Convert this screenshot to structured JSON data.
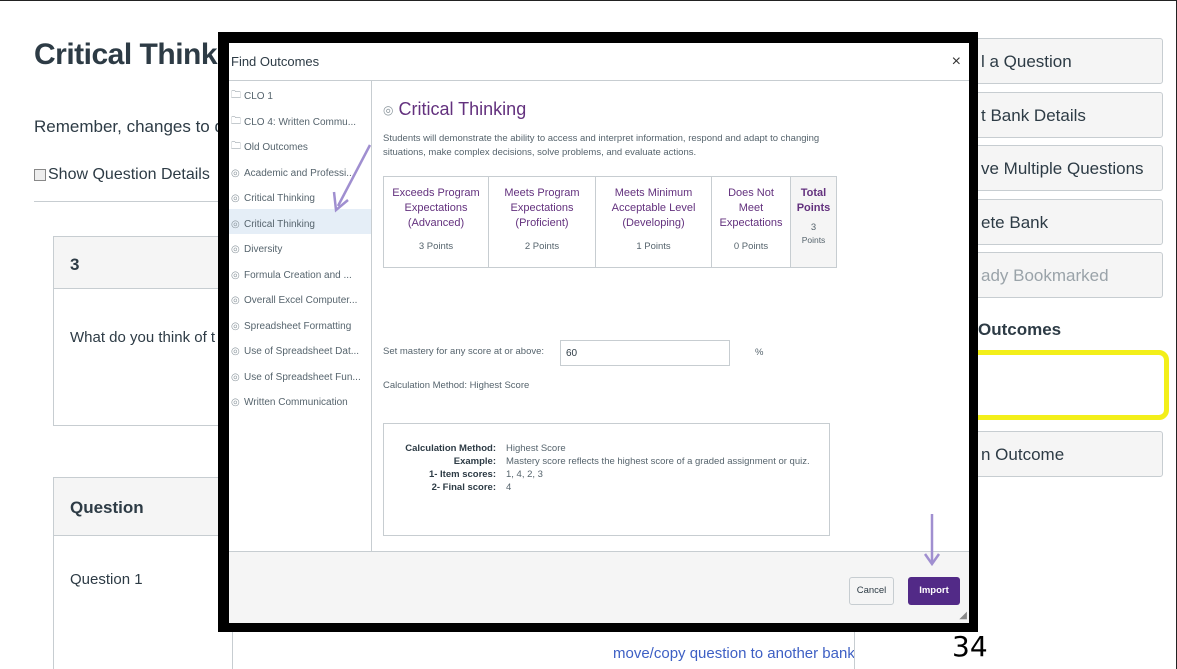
{
  "page": {
    "title": "Critical Thinki",
    "note": "Remember, changes to qu",
    "show_details_label": "Show Question Details",
    "question_card": {
      "number": "3",
      "text": "What do you think of t"
    },
    "question_card2": {
      "heading": "Question",
      "text": "Question 1"
    },
    "move_link": "move/copy question to another bank",
    "page_number": "34"
  },
  "sidebar": {
    "buttons": [
      {
        "label": "l a Question",
        "disabled": false
      },
      {
        "label": "t Bank Details",
        "disabled": false
      },
      {
        "label": "ve Multiple Questions",
        "disabled": false
      },
      {
        "label": "ete Bank",
        "disabled": false
      },
      {
        "label": "ady Bookmarked",
        "disabled": true
      },
      {
        "label": "n Outcome",
        "disabled": false
      }
    ],
    "outcomes_heading": "Outcomes"
  },
  "modal": {
    "title": "Find Outcomes",
    "close": "×",
    "tree": [
      {
        "label": "CLO 1",
        "icon": "folder-icon"
      },
      {
        "label": "CLO 4: Written Commu...",
        "icon": "folder-icon"
      },
      {
        "label": "Old Outcomes",
        "icon": "folder-icon"
      },
      {
        "label": "Academic and Professi...",
        "icon": "outcome-icon"
      },
      {
        "label": "Critical Thinking",
        "icon": "outcome-icon"
      },
      {
        "label": "Critical Thinking",
        "icon": "outcome-icon",
        "selected": true
      },
      {
        "label": "Diversity",
        "icon": "outcome-icon"
      },
      {
        "label": "Formula Creation and ...",
        "icon": "outcome-icon"
      },
      {
        "label": "Overall Excel Computer...",
        "icon": "outcome-icon"
      },
      {
        "label": "Spreadsheet Formatting",
        "icon": "outcome-icon"
      },
      {
        "label": "Use of Spreadsheet Dat...",
        "icon": "outcome-icon"
      },
      {
        "label": "Use of Spreadsheet Fun...",
        "icon": "outcome-icon"
      },
      {
        "label": "Written Communication",
        "icon": "outcome-icon"
      }
    ],
    "outcome": {
      "title": "Critical Thinking",
      "description": "Students will demonstrate the ability to access and interpret information, respond and adapt to changing situations, make complex decisions, solve problems, and evaluate actions.",
      "rubric": [
        {
          "label": "Exceeds Program Expectations (Advanced)",
          "points": "3 Points"
        },
        {
          "label": "Meets Program Expectations (Proficient)",
          "points": "2 Points"
        },
        {
          "label": "Meets Minimum Acceptable Level (Developing)",
          "points": "1 Points"
        },
        {
          "label": "Does Not Meet Expectations",
          "points": "0 Points"
        }
      ],
      "total": {
        "label": "Total Points",
        "value": "3",
        "unit": "Points"
      },
      "mastery_label": "Set mastery for any score at or above:",
      "mastery_value": "60",
      "mastery_unit": "%",
      "calc_method_label": "Calculation Method: Highest Score",
      "calc_box": {
        "method_key": "Calculation Method:",
        "method_val": "Highest Score",
        "example_key": "Example:",
        "example_val": "Mastery score reflects the highest score of a graded assignment or quiz.",
        "item_key": "1- Item scores:",
        "item_val": "1, 4, 2, 3",
        "final_key": "2- Final score:",
        "final_val": "4"
      }
    },
    "footer": {
      "cancel": "Cancel",
      "import": "Import"
    }
  },
  "colors": {
    "accent": "#522a87",
    "outcome_title": "#63317e",
    "highlight": "#f3ef1a",
    "arrow": "#a08fd0"
  }
}
